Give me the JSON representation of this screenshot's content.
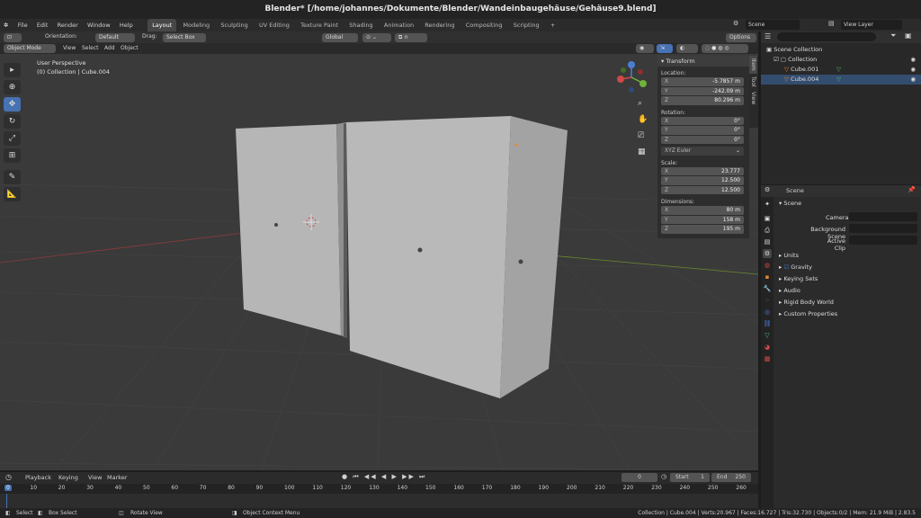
{
  "title": "Blender* [/home/johannes/Dokumente/Blender/Wandeinbaugehäuse/Gehäuse9.blend]",
  "menu": [
    "File",
    "Edit",
    "Render",
    "Window",
    "Help"
  ],
  "workspaces": [
    "Layout",
    "Modeling",
    "Sculpting",
    "UV Editing",
    "Texture Paint",
    "Shading",
    "Animation",
    "Rendering",
    "Compositing",
    "Scripting"
  ],
  "active_workspace": "Layout",
  "scene_name": "Scene",
  "view_layer": "View Layer",
  "header": {
    "orientation_label": "Orientation:",
    "orientation_value": "Default",
    "drag_label": "Drag:",
    "drag_value": "Select Box",
    "transform_orientation": "Global",
    "options": "Options"
  },
  "header2": {
    "mode": "Object Mode",
    "view": "View",
    "select": "Select",
    "add": "Add",
    "object": "Object"
  },
  "viewport": {
    "perspective": "User Perspective",
    "collection_info": "(0) Collection | Cube.004"
  },
  "npanel": {
    "title": "Transform",
    "location_label": "Location:",
    "location": [
      {
        "k": "X",
        "v": "-5.7857 m"
      },
      {
        "k": "Y",
        "v": "-242.09 m"
      },
      {
        "k": "Z",
        "v": "80.296 m"
      }
    ],
    "rotation_label": "Rotation:",
    "rotation": [
      {
        "k": "X",
        "v": "0°"
      },
      {
        "k": "Y",
        "v": "0°"
      },
      {
        "k": "Z",
        "v": "0°"
      }
    ],
    "rotation_mode": "XYZ Euler",
    "scale_label": "Scale:",
    "scale": [
      {
        "k": "X",
        "v": "23.777"
      },
      {
        "k": "Y",
        "v": "12.500"
      },
      {
        "k": "Z",
        "v": "12.500"
      }
    ],
    "dimensions_label": "Dimensions:",
    "dimensions": [
      {
        "k": "X",
        "v": "80 m"
      },
      {
        "k": "Y",
        "v": "158 m"
      },
      {
        "k": "Z",
        "v": "195 m"
      }
    ],
    "tabs": [
      "Item",
      "Tool",
      "View"
    ]
  },
  "outliner": {
    "root": "Scene Collection",
    "collection": "Collection",
    "objects": [
      "Cube.001",
      "Cube.004"
    ]
  },
  "properties": {
    "header": "Scene",
    "panel": "Scene",
    "camera_label": "Camera",
    "background_label": "Background Scene",
    "clip_label": "Active Clip",
    "sections": [
      "Units",
      "Gravity",
      "Keying Sets",
      "Audio",
      "Rigid Body World",
      "Custom Properties"
    ]
  },
  "timeline": {
    "menus": [
      "Playback",
      "Keying",
      "View",
      "Marker"
    ],
    "current_frame": "0",
    "start_label": "Start",
    "start": "1",
    "end_label": "End",
    "end": "250",
    "ruler": [
      "0",
      "10",
      "20",
      "30",
      "40",
      "50",
      "60",
      "70",
      "80",
      "90",
      "100",
      "110",
      "120",
      "130",
      "140",
      "150",
      "160",
      "170",
      "180",
      "190",
      "200",
      "210",
      "220",
      "230",
      "240",
      "250",
      "260"
    ]
  },
  "status": {
    "select": "Select",
    "box_select": "Box Select",
    "rotate_view": "Rotate View",
    "context_menu": "Object Context Menu",
    "stats": "Collection | Cube.004 | Verts:20.967 | Faces:16.727 | Tris:32.730 | Objects:0/2 | Mem: 21.9 MiB | 2.83.5"
  },
  "colors": {
    "accent": "#4772b3",
    "object_orange": "#e8872a",
    "mesh_green": "#4ec26a"
  }
}
